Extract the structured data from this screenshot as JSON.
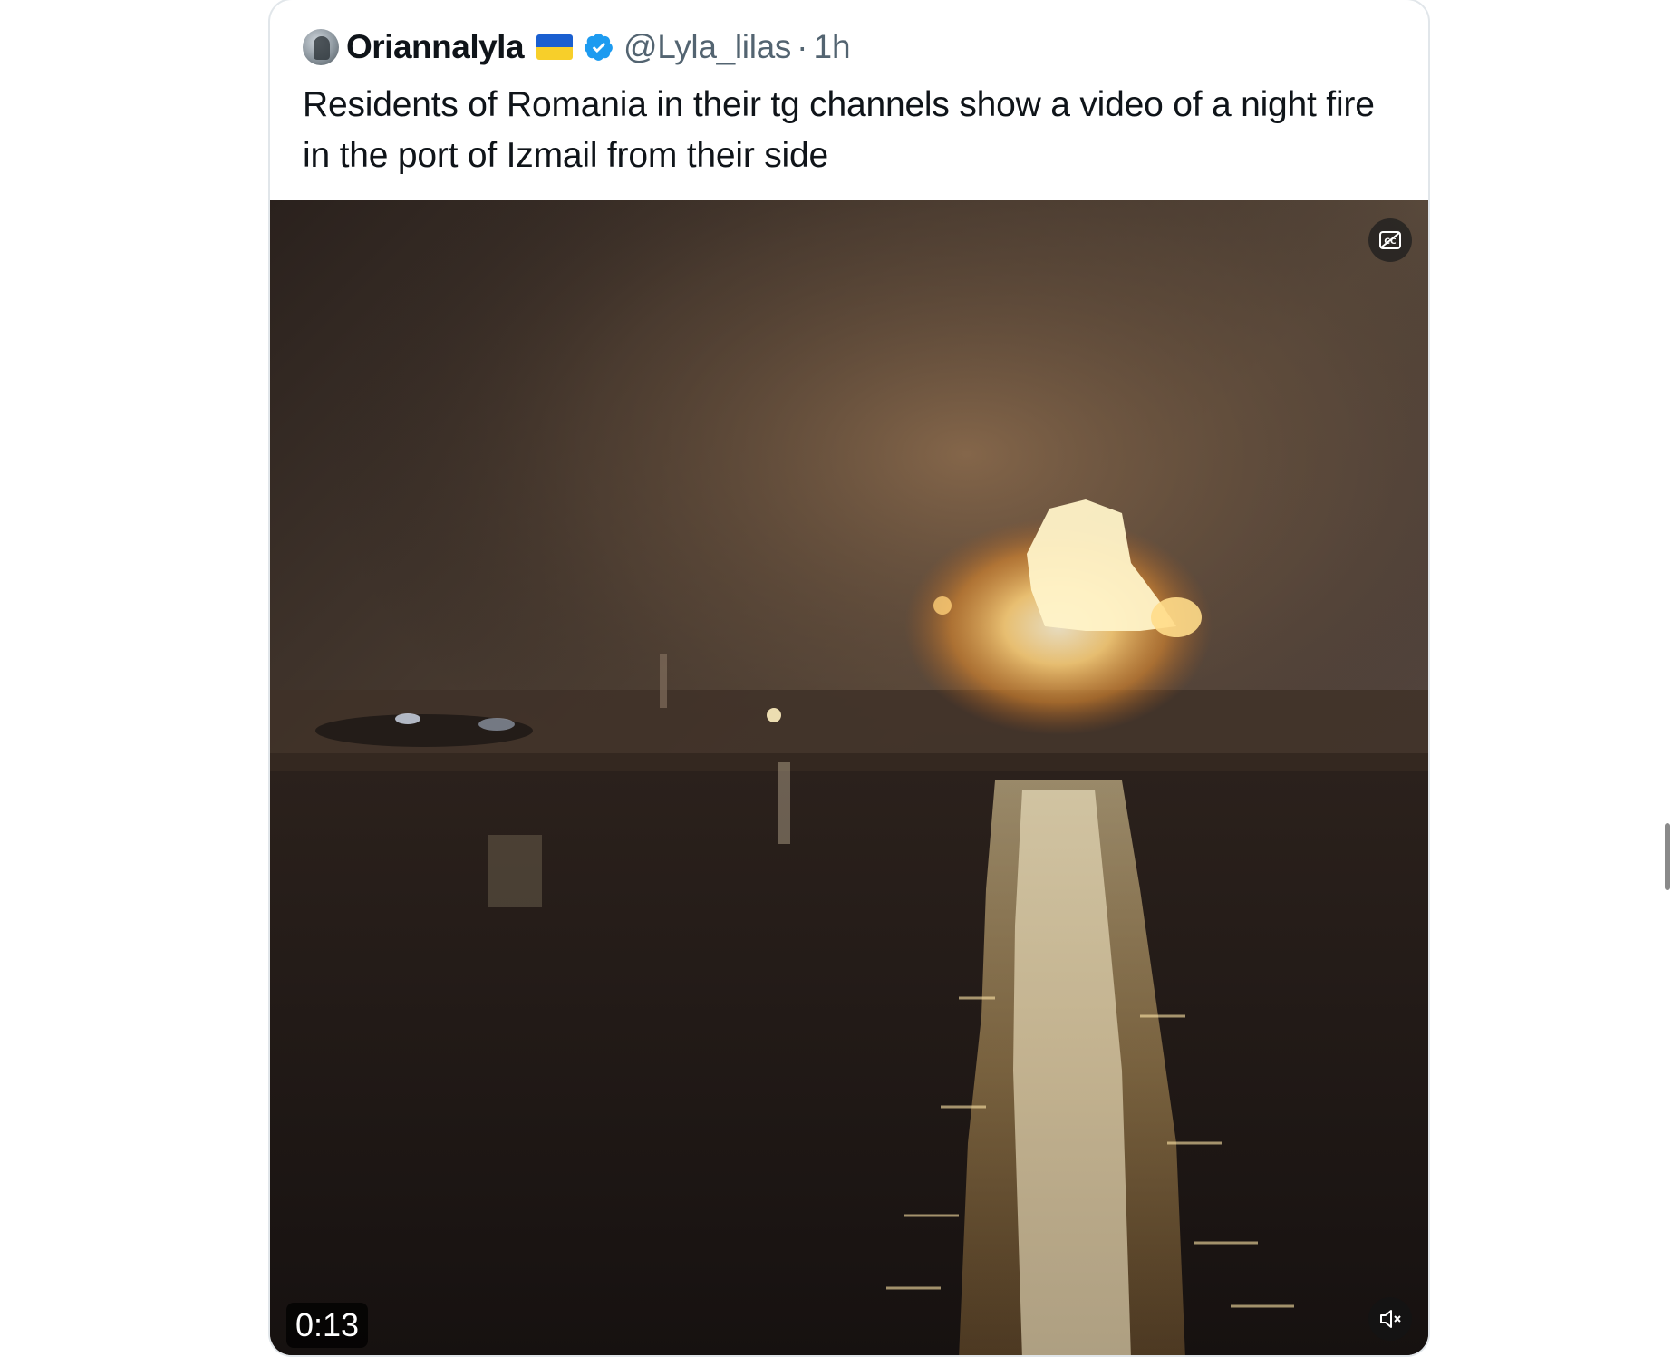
{
  "tweet": {
    "display_name": "Oriannalyla",
    "flag_icon": "ukraine-flag-icon",
    "verified_icon": "verified-badge-icon",
    "handle": "@Lyla_lilas",
    "separator": "·",
    "time": "1h",
    "text": "Residents of Romania in their tg channels show a video of a night fire in the port of Izmail from their side"
  },
  "video": {
    "duration": "0:13",
    "captions_icon": "closed-captions-icon",
    "mute_icon": "muted-speaker-icon"
  },
  "colors": {
    "text_primary": "#0f1419",
    "text_secondary": "#536471",
    "verified_blue": "#1d9bf0",
    "card_border": "#e1e6ea"
  }
}
